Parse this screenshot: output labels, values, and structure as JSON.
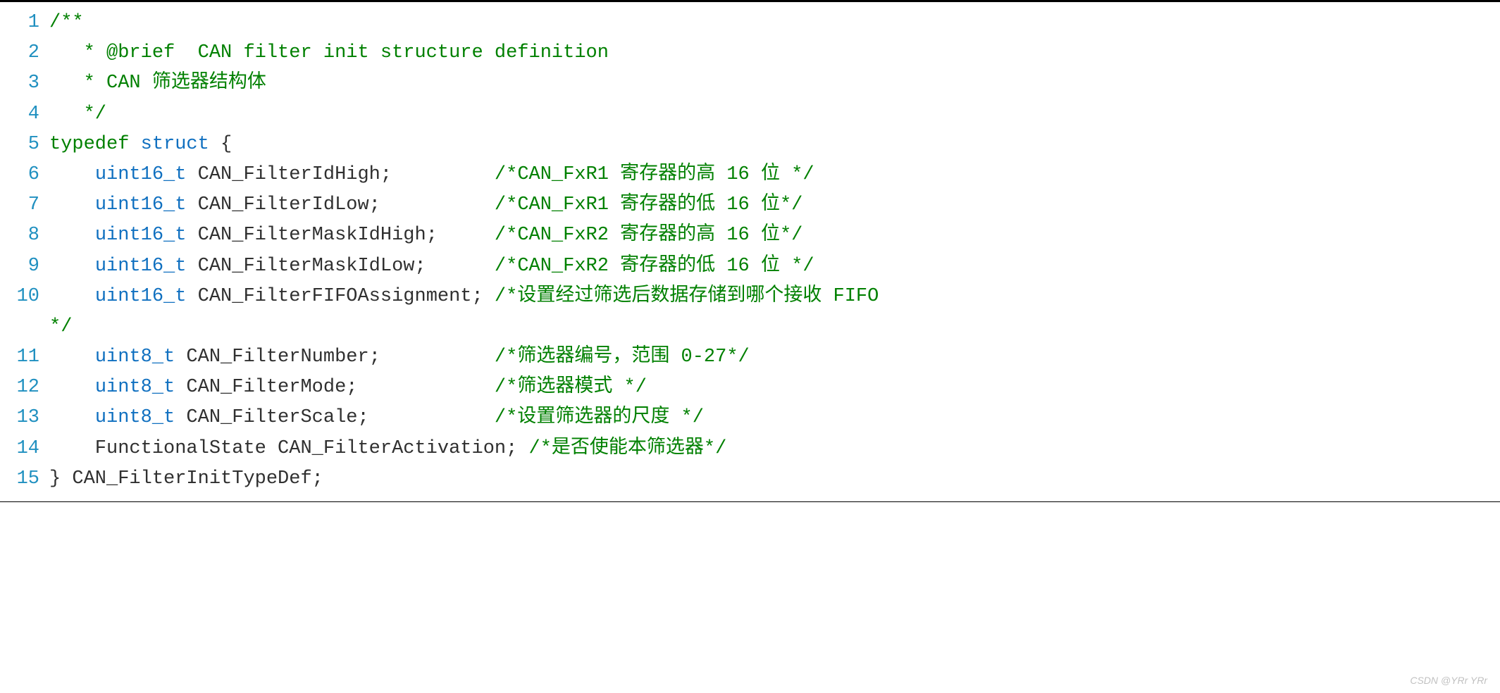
{
  "watermark": "CSDN @YRr YRr",
  "code": {
    "lines": [
      {
        "num": "1",
        "tokens": [
          {
            "cls": "c-comment",
            "txt": "/**"
          }
        ]
      },
      {
        "num": "2",
        "tokens": [
          {
            "cls": "c-comment",
            "txt": "   * @brief  CAN filter init structure definition"
          }
        ]
      },
      {
        "num": "3",
        "tokens": [
          {
            "cls": "c-comment",
            "txt": "   * CAN 筛选器结构体"
          }
        ]
      },
      {
        "num": "4",
        "tokens": [
          {
            "cls": "c-comment",
            "txt": "   */"
          }
        ]
      },
      {
        "num": "5",
        "tokens": [
          {
            "cls": "c-keyword",
            "txt": "typedef"
          },
          {
            "cls": "c-ident",
            "txt": " "
          },
          {
            "cls": "c-type",
            "txt": "struct"
          },
          {
            "cls": "c-ident",
            "txt": " "
          },
          {
            "cls": "c-punct",
            "txt": "{"
          }
        ]
      },
      {
        "num": "6",
        "tokens": [
          {
            "cls": "c-ident",
            "txt": "    "
          },
          {
            "cls": "c-type",
            "txt": "uint16_t"
          },
          {
            "cls": "c-ident",
            "txt": " CAN_FilterIdHigh"
          },
          {
            "cls": "c-punct",
            "txt": ";"
          },
          {
            "cls": "c-ident",
            "txt": "         "
          },
          {
            "cls": "c-comment",
            "txt": "/*CAN_FxR1 寄存器的高 16 位 */"
          }
        ]
      },
      {
        "num": "7",
        "tokens": [
          {
            "cls": "c-ident",
            "txt": "    "
          },
          {
            "cls": "c-type",
            "txt": "uint16_t"
          },
          {
            "cls": "c-ident",
            "txt": " CAN_FilterIdLow"
          },
          {
            "cls": "c-punct",
            "txt": ";"
          },
          {
            "cls": "c-ident",
            "txt": "          "
          },
          {
            "cls": "c-comment",
            "txt": "/*CAN_FxR1 寄存器的低 16 位*/"
          }
        ]
      },
      {
        "num": "8",
        "tokens": [
          {
            "cls": "c-ident",
            "txt": "    "
          },
          {
            "cls": "c-type",
            "txt": "uint16_t"
          },
          {
            "cls": "c-ident",
            "txt": " CAN_FilterMaskIdHigh"
          },
          {
            "cls": "c-punct",
            "txt": ";"
          },
          {
            "cls": "c-ident",
            "txt": "     "
          },
          {
            "cls": "c-comment",
            "txt": "/*CAN_FxR2 寄存器的高 16 位*/"
          }
        ]
      },
      {
        "num": "9",
        "tokens": [
          {
            "cls": "c-ident",
            "txt": "    "
          },
          {
            "cls": "c-type",
            "txt": "uint16_t"
          },
          {
            "cls": "c-ident",
            "txt": " CAN_FilterMaskIdLow"
          },
          {
            "cls": "c-punct",
            "txt": ";"
          },
          {
            "cls": "c-ident",
            "txt": "      "
          },
          {
            "cls": "c-comment",
            "txt": "/*CAN_FxR2 寄存器的低 16 位 */"
          }
        ]
      },
      {
        "num": "10",
        "tokens": [
          {
            "cls": "c-ident",
            "txt": "    "
          },
          {
            "cls": "c-type",
            "txt": "uint16_t"
          },
          {
            "cls": "c-ident",
            "txt": " CAN_FilterFIFOAssignment"
          },
          {
            "cls": "c-punct",
            "txt": ";"
          },
          {
            "cls": "c-ident",
            "txt": " "
          },
          {
            "cls": "c-comment",
            "txt": "/*设置经过筛选后数据存储到哪个接收 FIFO"
          }
        ]
      },
      {
        "num": "",
        "tokens": [
          {
            "cls": "c-comment",
            "txt": "*/"
          }
        ]
      },
      {
        "num": "11",
        "tokens": [
          {
            "cls": "c-ident",
            "txt": "    "
          },
          {
            "cls": "c-type",
            "txt": "uint8_t"
          },
          {
            "cls": "c-ident",
            "txt": " CAN_FilterNumber"
          },
          {
            "cls": "c-punct",
            "txt": ";"
          },
          {
            "cls": "c-ident",
            "txt": "          "
          },
          {
            "cls": "c-comment",
            "txt": "/*筛选器编号，范围 0-27*/"
          }
        ]
      },
      {
        "num": "12",
        "tokens": [
          {
            "cls": "c-ident",
            "txt": "    "
          },
          {
            "cls": "c-type",
            "txt": "uint8_t"
          },
          {
            "cls": "c-ident",
            "txt": " CAN_FilterMode"
          },
          {
            "cls": "c-punct",
            "txt": ";"
          },
          {
            "cls": "c-ident",
            "txt": "            "
          },
          {
            "cls": "c-comment",
            "txt": "/*筛选器模式 */"
          }
        ]
      },
      {
        "num": "13",
        "tokens": [
          {
            "cls": "c-ident",
            "txt": "    "
          },
          {
            "cls": "c-type",
            "txt": "uint8_t"
          },
          {
            "cls": "c-ident",
            "txt": " CAN_FilterScale"
          },
          {
            "cls": "c-punct",
            "txt": ";"
          },
          {
            "cls": "c-ident",
            "txt": "           "
          },
          {
            "cls": "c-comment",
            "txt": "/*设置筛选器的尺度 */"
          }
        ]
      },
      {
        "num": "14",
        "tokens": [
          {
            "cls": "c-ident",
            "txt": "    FunctionalState CAN_FilterActivation"
          },
          {
            "cls": "c-punct",
            "txt": ";"
          },
          {
            "cls": "c-ident",
            "txt": " "
          },
          {
            "cls": "c-comment",
            "txt": "/*是否使能本筛选器*/"
          }
        ]
      },
      {
        "num": "15",
        "tokens": [
          {
            "cls": "c-punct",
            "txt": "}"
          },
          {
            "cls": "c-ident",
            "txt": " CAN_FilterInitTypeDef"
          },
          {
            "cls": "c-punct",
            "txt": ";"
          }
        ]
      }
    ]
  }
}
